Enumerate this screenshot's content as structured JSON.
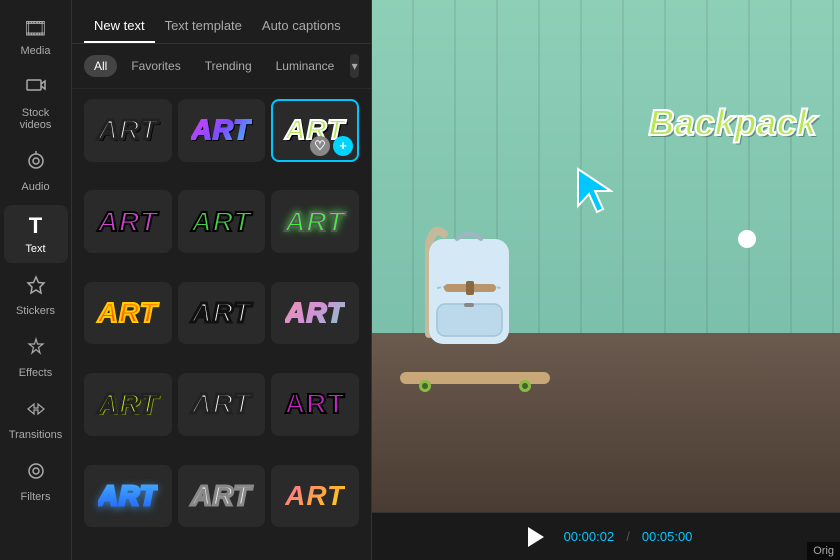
{
  "sidebar": {
    "items": [
      {
        "id": "media",
        "label": "Media",
        "icon": "🎞"
      },
      {
        "id": "stock-videos",
        "label": "Stock\nvideos",
        "icon": "▦"
      },
      {
        "id": "audio",
        "label": "Audio",
        "icon": "♪"
      },
      {
        "id": "text",
        "label": "Text",
        "icon": "T",
        "active": true
      },
      {
        "id": "stickers",
        "label": "Stickers",
        "icon": "★"
      },
      {
        "id": "effects",
        "label": "Effects",
        "icon": "✦"
      },
      {
        "id": "transitions",
        "label": "Transitions",
        "icon": "⇄"
      },
      {
        "id": "filters",
        "label": "Filters",
        "icon": "◎"
      }
    ]
  },
  "panel": {
    "tabs": [
      {
        "id": "new-text",
        "label": "New text",
        "active": true
      },
      {
        "id": "text-template",
        "label": "Text template",
        "active": false
      },
      {
        "id": "auto-captions",
        "label": "Auto captions",
        "active": false
      }
    ],
    "filters": [
      {
        "id": "all",
        "label": "All",
        "active": true
      },
      {
        "id": "favorites",
        "label": "Favorites",
        "active": false
      },
      {
        "id": "trending",
        "label": "Trending",
        "active": false
      },
      {
        "id": "luminance",
        "label": "Luminance",
        "active": false
      }
    ],
    "dropdown_icon": "▾",
    "art_styles": [
      {
        "id": 1,
        "style_class": "style-1",
        "text": "ART"
      },
      {
        "id": 2,
        "style_class": "style-2",
        "text": "ART"
      },
      {
        "id": 3,
        "style_class": "style-3",
        "text": "ART",
        "selected": true
      },
      {
        "id": 4,
        "style_class": "style-4",
        "text": "ART"
      },
      {
        "id": 5,
        "style_class": "style-5",
        "text": "ART"
      },
      {
        "id": 6,
        "style_class": "style-6",
        "text": "ART"
      },
      {
        "id": 7,
        "style_class": "style-7",
        "text": "ART"
      },
      {
        "id": 8,
        "style_class": "style-8",
        "text": "ART"
      },
      {
        "id": 9,
        "style_class": "style-9",
        "text": "ART"
      },
      {
        "id": 10,
        "style_class": "style-10",
        "text": "ART"
      },
      {
        "id": 11,
        "style_class": "style-11",
        "text": "ART"
      },
      {
        "id": 12,
        "style_class": "style-12",
        "text": "ART"
      },
      {
        "id": 13,
        "style_class": "style-13",
        "text": "ART"
      },
      {
        "id": 14,
        "style_class": "style-14",
        "text": "ART"
      },
      {
        "id": 15,
        "style_class": "style-15",
        "text": "ART"
      }
    ]
  },
  "preview": {
    "backpack_label": "Backpack",
    "time_current": "00:00:02",
    "time_total": "00:05:00",
    "orig_label": "Orig"
  }
}
